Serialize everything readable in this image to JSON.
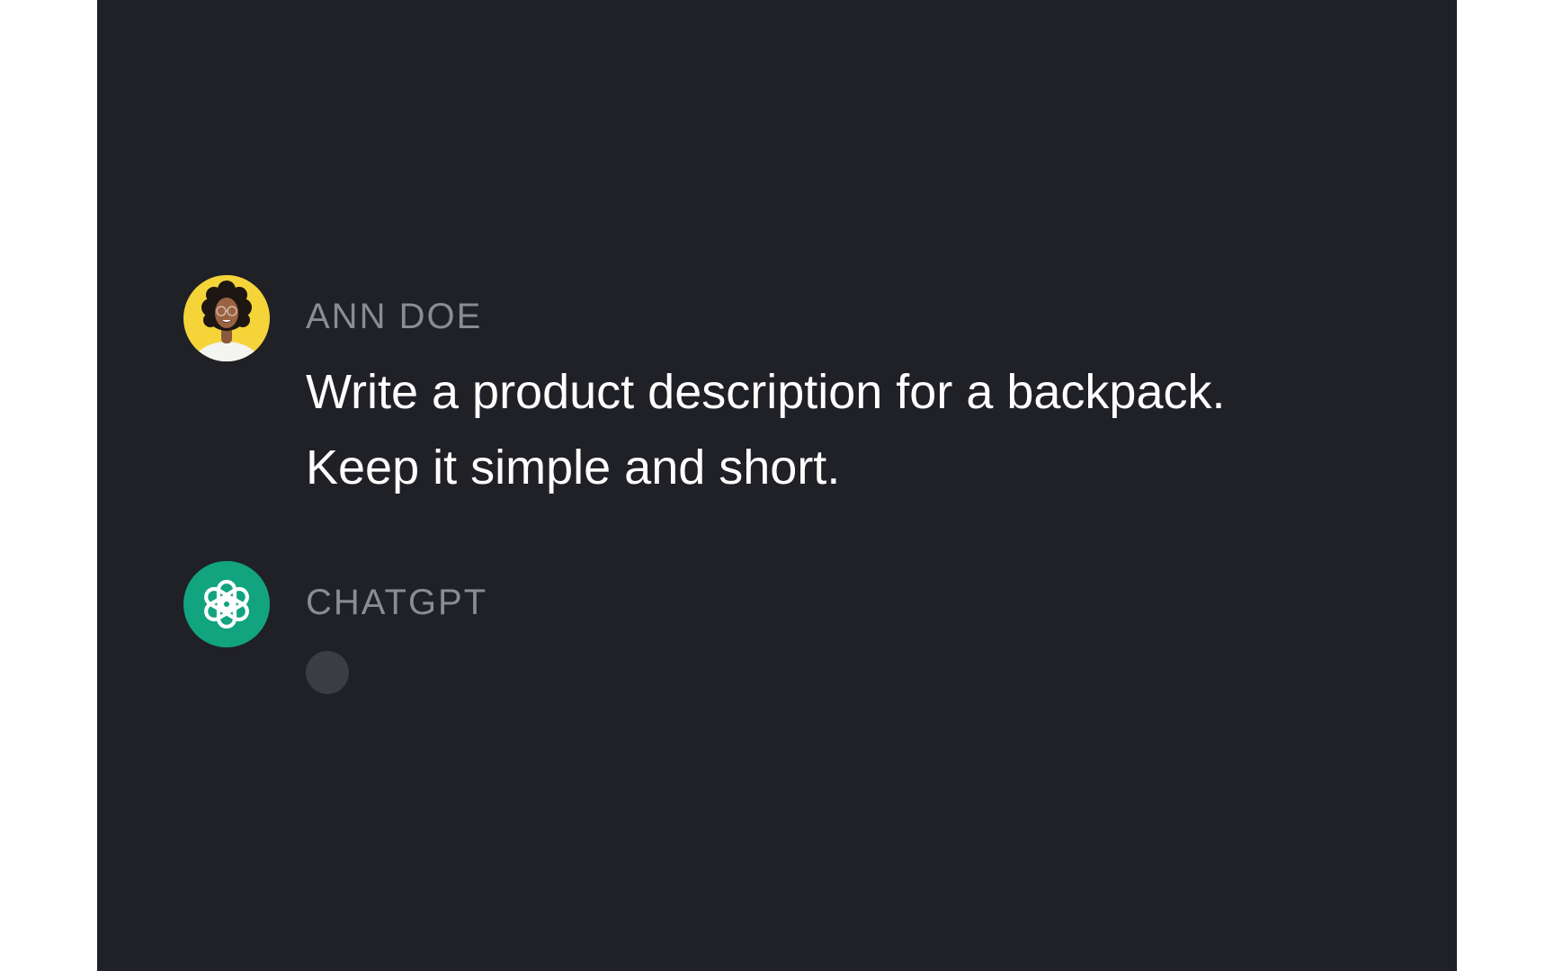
{
  "conversation": {
    "user_message": {
      "author": "ANN DOE",
      "text_line_1": "Write a product description for a backpack.",
      "text_line_2": "Keep it simple and short."
    },
    "assistant_message": {
      "author": "CHATGPT",
      "status": "typing"
    }
  },
  "icons": {
    "user_avatar": "user-photo-avatar",
    "assistant_avatar": "openai-logo-icon",
    "typing_indicator": "typing-dot"
  },
  "colors": {
    "panel_background": "#202027",
    "author_label": "#8b8b93",
    "message_text": "#ffffff",
    "user_avatar_background": "#f5d43a",
    "assistant_avatar_background": "#12a37f",
    "typing_dot": "#3c3c45"
  }
}
